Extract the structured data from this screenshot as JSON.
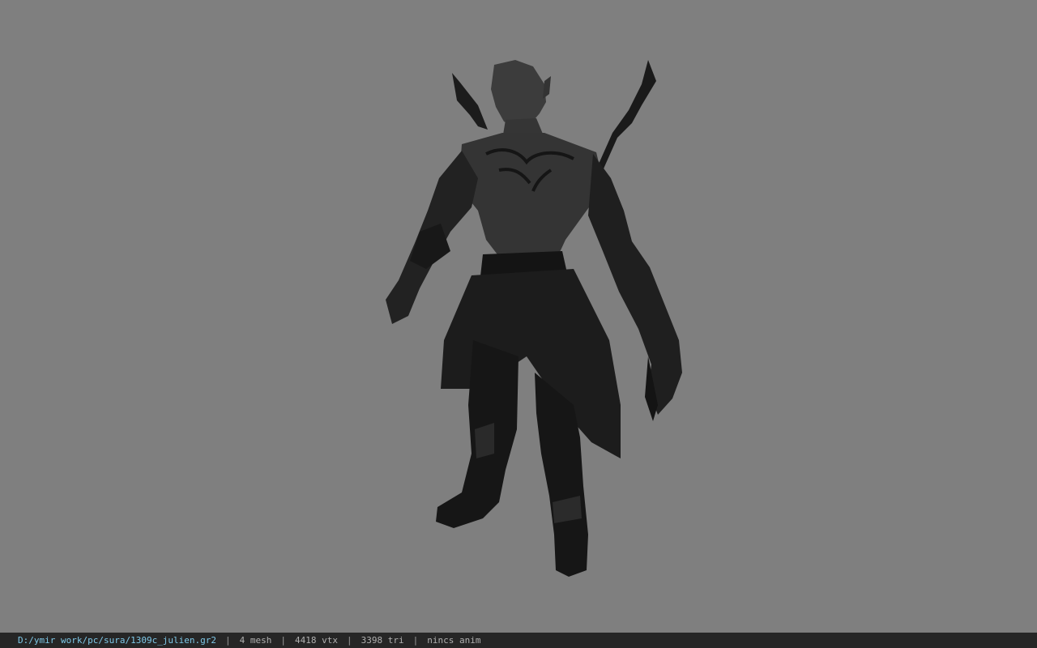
{
  "viewport": {
    "background": "#7f7f7f",
    "model_icon": "character-model"
  },
  "status_bar": {
    "file_path": "D:/ymir work/pc/sura/1309c_julien.gr2",
    "separator": "|",
    "mesh_count": "4 mesh",
    "vertex_count": "4418 vtx",
    "triangle_count": "3398 tri",
    "animation": "nincs anim"
  }
}
